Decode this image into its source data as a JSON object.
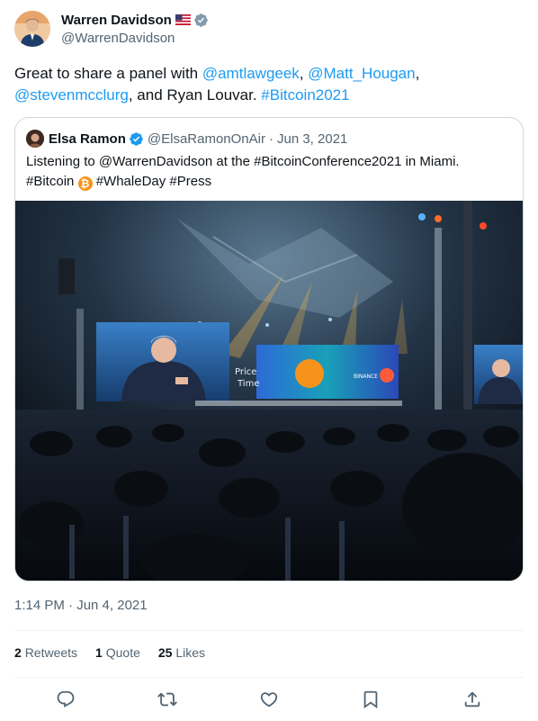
{
  "author": {
    "display_name": "Warren Davidson",
    "handle": "@WarrenDavidson",
    "flag_icon": "us-flag-icon",
    "verified_color": "#829aab"
  },
  "tweet": {
    "parts": [
      {
        "text": "Great to share a panel with ",
        "type": "text"
      },
      {
        "text": "@amtlawgeek",
        "type": "mention"
      },
      {
        "text": ", ",
        "type": "text"
      },
      {
        "text": "@Matt_Hougan",
        "type": "mention"
      },
      {
        "text": ", ",
        "type": "text"
      },
      {
        "text": "@stevenmcclurg",
        "type": "mention"
      },
      {
        "text": ", and Ryan Louvar. ",
        "type": "text"
      },
      {
        "text": "#Bitcoin2021",
        "type": "hashtag"
      }
    ]
  },
  "quote": {
    "display_name": "Elsa Ramon",
    "handle": "@ElsaRamonOnAir",
    "separator": "·",
    "date": "Jun 3, 2021",
    "line1": "Listening to @WarrenDavidson at the #BitcoinConference2021 in Miami.",
    "line2_a": "#Bitcoin",
    "bitcoin_emoji": "₿",
    "line2_b": "#WhaleDay #Press",
    "verified_color": "#1d9bf0"
  },
  "timestamp": "1:14 PM · Jun 4, 2021",
  "stats": {
    "retweets_count": "2",
    "retweets_label": "Retweets",
    "quotes_count": "1",
    "quotes_label": "Quote",
    "likes_count": "25",
    "likes_label": "Likes"
  },
  "actions": [
    "reply-icon",
    "retweet-icon",
    "like-icon",
    "bookmark-icon",
    "share-icon"
  ],
  "colors": {
    "link": "#1d9bf0",
    "secondary_text": "#536471",
    "border": "#cfd9de"
  }
}
